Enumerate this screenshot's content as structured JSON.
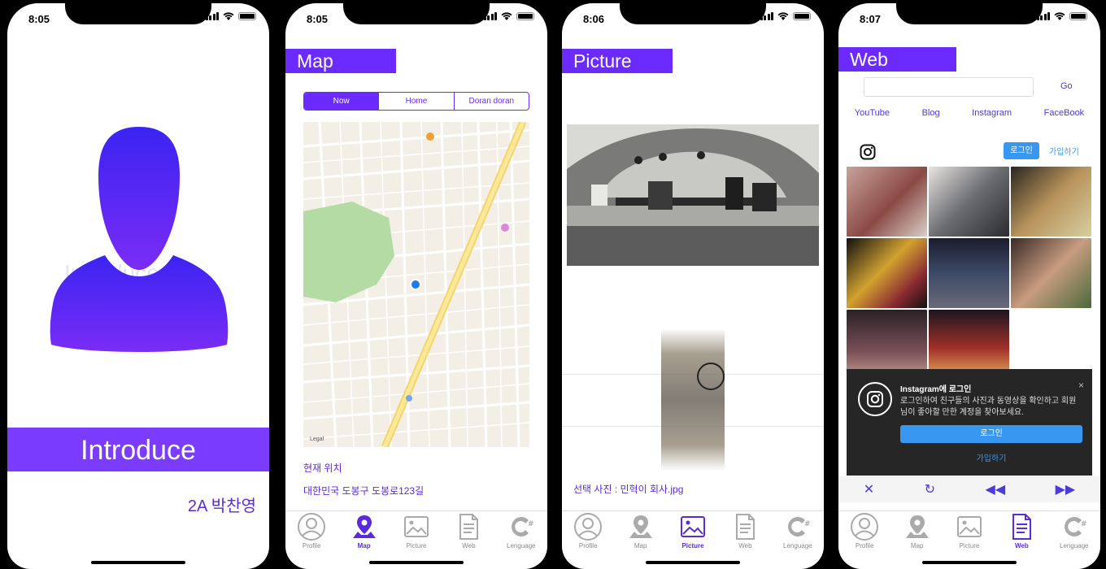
{
  "colors": {
    "accent": "#6b2bff",
    "intro_bar": "#7b3cff",
    "text_purple": "#5b2bd9",
    "link_blue": "#4b3bd9",
    "ig_blue": "#3897f0"
  },
  "tabs": [
    "Profile",
    "Map",
    "Picture",
    "Web",
    "Lenguage"
  ],
  "screens": {
    "profile": {
      "time": "8:05",
      "watermark": "Introduce Me",
      "intro_label": "Introduce",
      "author": "2A 박찬영"
    },
    "map": {
      "time": "8:05",
      "title": "Map",
      "segments": [
        "Now",
        "Home",
        "Doran doran"
      ],
      "map_legal": "Legal",
      "location_label": "현재 위치",
      "address": "대한민국 도봉구 도봉로123길"
    },
    "picture": {
      "time": "8:06",
      "title": "Picture",
      "selected_photo": "선택 사진 : 민혁이 회사.jpg"
    },
    "web": {
      "time": "8:07",
      "title": "Web",
      "url_value": "",
      "go_label": "Go",
      "links": [
        "YouTube",
        "Blog",
        "Instagram",
        "FaceBook"
      ],
      "ig_login_button": "로그인",
      "ig_signup_link": "가입하기",
      "modal_title": "Instagram에 로그인",
      "modal_close": "×",
      "modal_description": "로그인하여 친구들의 사진과 동영상을 확인하고 회원님이 좋아할 만한 계정을 찾아보세요.",
      "modal_login_button": "로그인",
      "modal_signup_link": "가입하기",
      "nav": {
        "close": "✕",
        "reload": "↻",
        "back": "◀◀",
        "forward": "▶▶"
      }
    }
  }
}
